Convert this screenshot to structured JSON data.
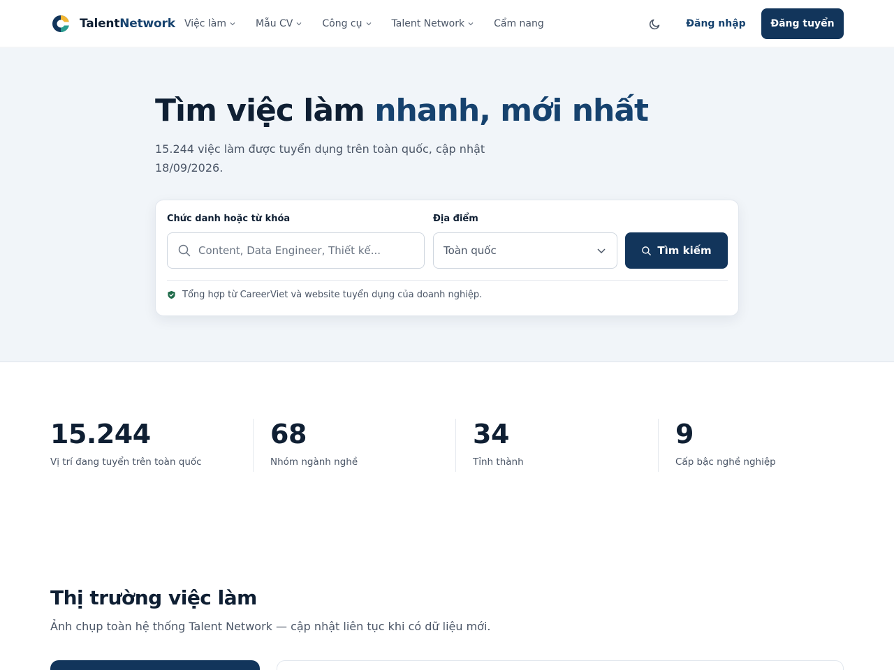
{
  "brand": {
    "name_a": "Talent",
    "name_b": "Network"
  },
  "nav": [
    {
      "label": "Việc làm",
      "has_dropdown": true
    },
    {
      "label": "Mẫu CV",
      "has_dropdown": true
    },
    {
      "label": "Công cụ",
      "has_dropdown": true
    },
    {
      "label": "Talent Network",
      "has_dropdown": true
    },
    {
      "label": "Cẩm nang",
      "has_dropdown": false
    }
  ],
  "header": {
    "theme_icon": "moon-icon",
    "login_label": "Đăng nhập",
    "post_label": "Đăng tuyển"
  },
  "hero": {
    "title_part1": "Tìm việc làm ",
    "title_part2": "nhanh, mới nhất",
    "subtitle": "15.244 việc làm được tuyển dụng trên toàn quốc, cập nhật 18/09/2026."
  },
  "search": {
    "keyword_label": "Chức danh hoặc từ khóa",
    "keyword_placeholder": "Content, Data Engineer, Thiết kế...",
    "keyword_value": "",
    "location_label": "Địa điểm",
    "location_value": "Toàn quốc",
    "button_label": "Tìm kiếm",
    "source_note": "Tổng hợp từ CareerViet và website tuyển dụng của doanh nghiệp."
  },
  "stats": [
    {
      "value": "15.244",
      "label": "Vị trí đang tuyển trên toàn quốc"
    },
    {
      "value": "68",
      "label": "Nhóm ngành nghề"
    },
    {
      "value": "34",
      "label": "Tỉnh thành"
    },
    {
      "value": "9",
      "label": "Cấp bậc nghề nghiệp"
    }
  ],
  "market": {
    "title": "Thị trường việc làm",
    "subtitle": "Ảnh chụp toàn hệ thống Talent Network — cập nhật liên tục khi có dữ liệu mới."
  },
  "colors": {
    "primary": "#12355b",
    "accent": "#16426e",
    "text": "#0f1f33",
    "muted": "#4a5566",
    "hero_bg": "#f1f5f9",
    "shield": "#1f6b4a"
  },
  "icons": {
    "logo": "talentnetwork-logo-icon",
    "search": "search-icon",
    "chevron": "chevron-down-icon",
    "shield": "shield-check-icon"
  }
}
